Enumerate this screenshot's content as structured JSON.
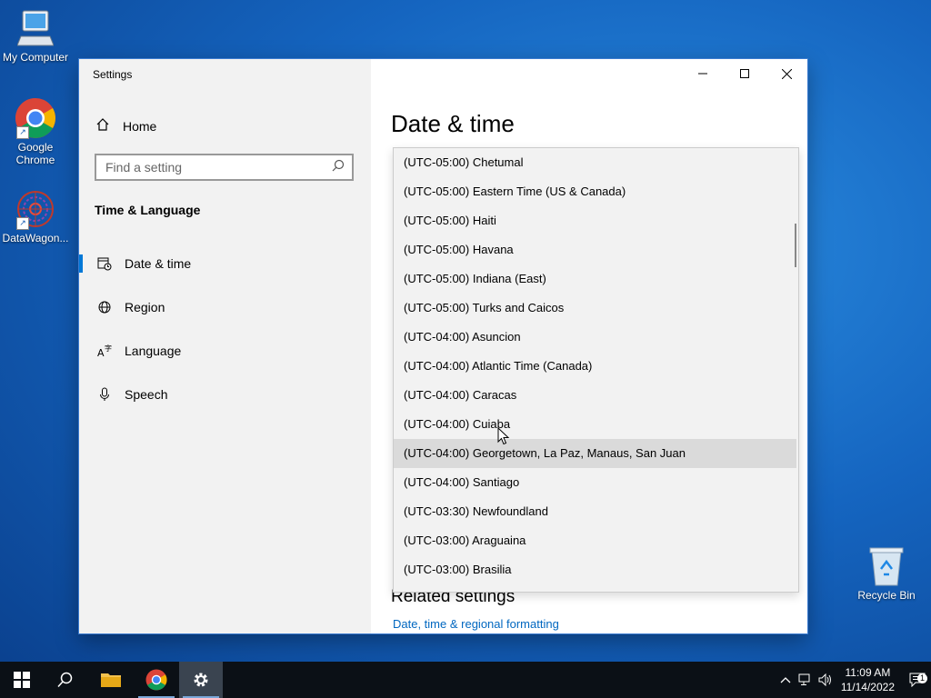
{
  "desktop": {
    "icons": [
      {
        "label": "My Computer"
      },
      {
        "label": "Google Chrome"
      },
      {
        "label": "DataWagon..."
      },
      {
        "label": "Recycle Bin"
      }
    ]
  },
  "window": {
    "title": "Settings",
    "sidebar": {
      "home_label": "Home",
      "search_placeholder": "Find a setting",
      "section_title": "Time & Language",
      "items": [
        {
          "label": "Date & time",
          "icon": "calendar-clock-icon",
          "active": true
        },
        {
          "label": "Region",
          "icon": "globe-icon",
          "active": false
        },
        {
          "label": "Language",
          "icon": "language-icon",
          "active": false
        },
        {
          "label": "Speech",
          "icon": "microphone-icon",
          "active": false
        }
      ]
    },
    "content": {
      "page_title": "Date & time",
      "related_title": "Related settings",
      "related_link": "Date, time & regional formatting"
    },
    "timezone_dropdown": {
      "items": [
        "(UTC-05:00) Chetumal",
        "(UTC-05:00) Eastern Time (US & Canada)",
        "(UTC-05:00) Haiti",
        "(UTC-05:00) Havana",
        "(UTC-05:00) Indiana (East)",
        "(UTC-05:00) Turks and Caicos",
        "(UTC-04:00) Asuncion",
        "(UTC-04:00) Atlantic Time (Canada)",
        "(UTC-04:00) Caracas",
        "(UTC-04:00) Cuiaba",
        "(UTC-04:00) Georgetown, La Paz, Manaus, San Juan",
        "(UTC-04:00) Santiago",
        "(UTC-03:30) Newfoundland",
        "(UTC-03:00) Araguaina",
        "(UTC-03:00) Brasilia"
      ],
      "highlighted_index": 10
    }
  },
  "taskbar": {
    "time": "11:09 AM",
    "date": "11/14/2022",
    "notification_count": "1"
  },
  "colors": {
    "accent": "#0078d7",
    "link": "#0067c0",
    "taskbar": "#0b1016"
  }
}
